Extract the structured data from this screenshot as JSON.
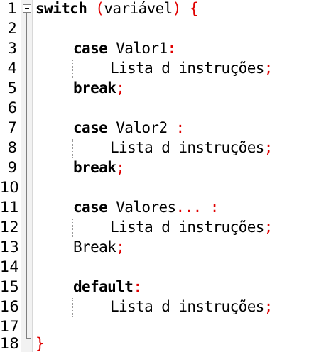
{
  "lines": [
    {
      "num": "1",
      "parts": [
        "switch",
        " (",
        "variável",
        ") {"
      ]
    },
    {
      "num": "2",
      "parts": []
    },
    {
      "num": "3",
      "parts": [
        "case",
        " Valor1",
        ":"
      ]
    },
    {
      "num": "4",
      "parts": [
        "Lista d instruções",
        ";"
      ]
    },
    {
      "num": "5",
      "parts": [
        "break",
        ";"
      ]
    },
    {
      "num": "6",
      "parts": []
    },
    {
      "num": "7",
      "parts": [
        "case",
        " Valor2 ",
        ":"
      ]
    },
    {
      "num": "8",
      "parts": [
        "Lista d instruções",
        ";"
      ]
    },
    {
      "num": "9",
      "parts": [
        "break",
        ";"
      ]
    },
    {
      "num": "10",
      "parts": []
    },
    {
      "num": "11",
      "parts": [
        "case",
        " Valores",
        "... :"
      ]
    },
    {
      "num": "12",
      "parts": [
        "Lista d instruções",
        ";"
      ]
    },
    {
      "num": "13",
      "parts": [
        "Break",
        ";"
      ]
    },
    {
      "num": "14",
      "parts": []
    },
    {
      "num": "15",
      "parts": [
        "default",
        ":"
      ]
    },
    {
      "num": "16",
      "parts": [
        "Lista d instruções",
        ";"
      ]
    },
    {
      "num": "17",
      "parts": []
    },
    {
      "num": "18",
      "parts": [
        "}"
      ]
    }
  ],
  "colors": {
    "keyword": "#000000",
    "operator": "#e00000",
    "text": "#000000",
    "background": "#ffffff"
  }
}
